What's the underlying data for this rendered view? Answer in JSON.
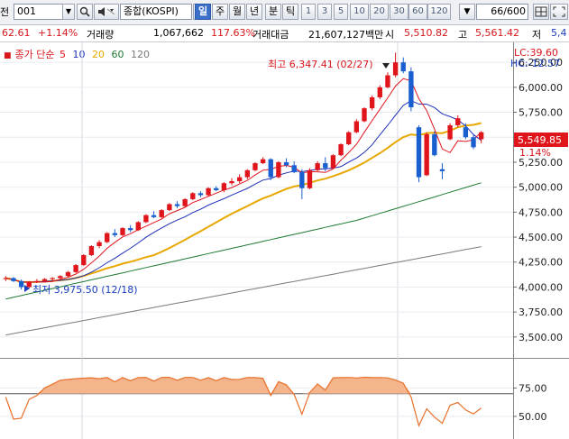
{
  "toolbar": {
    "partial_left": "전",
    "code": "001",
    "search_icon": "search-icon",
    "sound_icon": "speaker-icon",
    "name": "종합(KOSPI)",
    "periods": [
      "일",
      "주",
      "월",
      "년",
      "분",
      "틱"
    ],
    "active_period": "일",
    "numbers": [
      "1",
      "3",
      "5",
      "10",
      "20",
      "30",
      "60",
      "120"
    ],
    "count": "66",
    "count_total": "/600",
    "scroll_prev_icon": "chevron-left-icon",
    "scroll_next_icon": "chevron-down-icon",
    "tool_icons": [
      "grid-icon",
      "fit-icon"
    ]
  },
  "infobar": {
    "price": "62.61",
    "change": "+1.14%",
    "volume_label": "거래량",
    "volume": "1,067,662",
    "volume_ratio": "117.63%",
    "amount_label": "거래대금",
    "amount": "21,607,127백만",
    "open_label": "시",
    "open": "5,510.82",
    "high_label": "고",
    "high": "5,561.42",
    "low_label": "저",
    "low": "5,4"
  },
  "legend": {
    "prefix": "종가 단순",
    "periods": [
      "5",
      "10",
      "20",
      "60",
      "120"
    ],
    "colors": [
      "#e0141b",
      "#1c2fb8",
      "#e8a800",
      "#1e7a34",
      "#7a7a7a"
    ]
  },
  "chart": {
    "lc_label": "LC:39.60",
    "hc_label": "HC:-12.57",
    "max_annotation": "최고 6,347.41 (02/27)",
    "min_annotation": "최저 3,975.50 (12/18)",
    "current_price": "5,549.85",
    "current_change": "1.14%",
    "up_color": "#e0141b",
    "down_color": "#1a5fd0"
  },
  "chart_data": {
    "type": "candlestick",
    "ylim": [
      3300,
      6450
    ],
    "y_ticks": [
      "6,250.00",
      "6,000.00",
      "5,750.00",
      "5,500.00",
      "5,250.00",
      "5,000.00",
      "4,750.00",
      "4,500.00",
      "4,250.00",
      "4,000.00",
      "3,750.00",
      "3,500.00"
    ],
    "y_tick_values": [
      6250,
      6000,
      5750,
      5500,
      5250,
      5000,
      4750,
      4500,
      4250,
      4000,
      3750,
      3500
    ],
    "candles": [
      [
        4080,
        4110,
        4060,
        4090
      ],
      [
        4090,
        4100,
        4050,
        4060
      ],
      [
        4060,
        4075,
        3975,
        4000
      ],
      [
        4000,
        4060,
        3990,
        4050
      ],
      [
        4050,
        4080,
        4040,
        4060
      ],
      [
        4060,
        4090,
        4050,
        4080
      ],
      [
        4080,
        4100,
        4060,
        4090
      ],
      [
        4090,
        4120,
        4080,
        4110
      ],
      [
        4110,
        4160,
        4100,
        4150
      ],
      [
        4150,
        4230,
        4140,
        4220
      ],
      [
        4220,
        4330,
        4210,
        4320
      ],
      [
        4320,
        4420,
        4310,
        4410
      ],
      [
        4410,
        4470,
        4390,
        4450
      ],
      [
        4450,
        4550,
        4440,
        4540
      ],
      [
        4540,
        4580,
        4500,
        4520
      ],
      [
        4520,
        4600,
        4510,
        4590
      ],
      [
        4590,
        4620,
        4550,
        4570
      ],
      [
        4570,
        4660,
        4560,
        4650
      ],
      [
        4650,
        4730,
        4640,
        4720
      ],
      [
        4720,
        4760,
        4690,
        4700
      ],
      [
        4700,
        4780,
        4690,
        4770
      ],
      [
        4770,
        4840,
        4760,
        4830
      ],
      [
        4830,
        4860,
        4790,
        4810
      ],
      [
        4810,
        4890,
        4800,
        4880
      ],
      [
        4880,
        4950,
        4870,
        4940
      ],
      [
        4940,
        4960,
        4900,
        4920
      ],
      [
        4920,
        5000,
        4910,
        4990
      ],
      [
        4990,
        5010,
        4960,
        4970
      ],
      [
        4970,
        5050,
        4950,
        5040
      ],
      [
        5040,
        5090,
        5020,
        5060
      ],
      [
        5060,
        5130,
        5040,
        5100
      ],
      [
        5100,
        5180,
        5080,
        5170
      ],
      [
        5170,
        5250,
        5160,
        5240
      ],
      [
        5240,
        5300,
        5230,
        5280
      ],
      [
        5280,
        5290,
        5070,
        5100
      ],
      [
        5100,
        5260,
        5090,
        5250
      ],
      [
        5250,
        5290,
        5200,
        5220
      ],
      [
        5220,
        5260,
        5140,
        5150
      ],
      [
        5150,
        5180,
        4880,
        4990
      ],
      [
        4990,
        5190,
        4980,
        5170
      ],
      [
        5170,
        5260,
        5160,
        5240
      ],
      [
        5240,
        5300,
        5160,
        5190
      ],
      [
        5190,
        5330,
        5180,
        5320
      ],
      [
        5320,
        5440,
        5310,
        5430
      ],
      [
        5430,
        5560,
        5420,
        5550
      ],
      [
        5550,
        5680,
        5540,
        5660
      ],
      [
        5660,
        5800,
        5650,
        5790
      ],
      [
        5790,
        5920,
        5770,
        5900
      ],
      [
        5900,
        6020,
        5880,
        6000
      ],
      [
        6000,
        6150,
        5990,
        6120
      ],
      [
        6120,
        6347,
        6100,
        6250
      ],
      [
        6250,
        6300,
        6140,
        6160
      ],
      [
        6160,
        6200,
        5760,
        5800
      ],
      [
        5600,
        5620,
        5050,
        5100
      ],
      [
        5120,
        5550,
        5110,
        5530
      ],
      [
        5530,
        5560,
        5310,
        5320
      ],
      [
        5180,
        5240,
        5080,
        5160
      ],
      [
        5480,
        5640,
        5470,
        5620
      ],
      [
        5620,
        5720,
        5600,
        5690
      ],
      [
        5600,
        5640,
        5480,
        5500
      ],
      [
        5500,
        5520,
        5380,
        5400
      ],
      [
        5480,
        5561,
        5440,
        5550
      ]
    ],
    "indicator": {
      "ylim": [
        30,
        100
      ],
      "ticks": [
        "75.00",
        "50.00"
      ],
      "tick_values": [
        75,
        50
      ],
      "ref_line": 70
    }
  }
}
